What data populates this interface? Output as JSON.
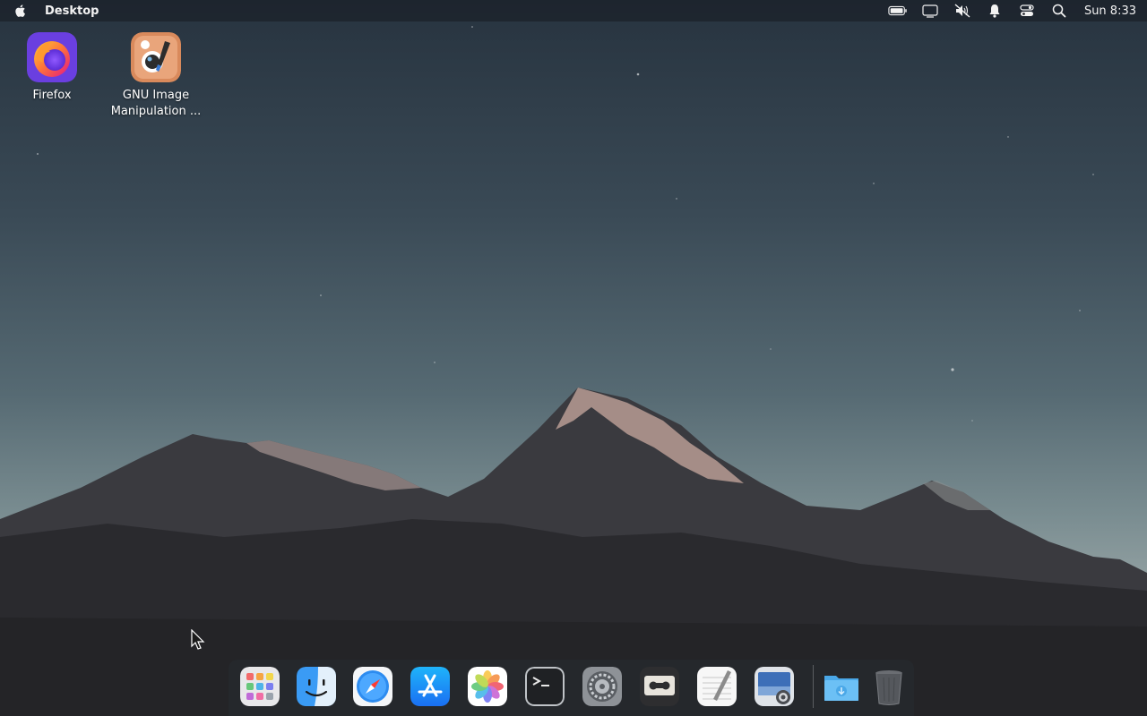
{
  "menubar": {
    "active_app": "Desktop",
    "clock": "Sun 8:33",
    "status_icons": [
      "battery-icon",
      "display-icon",
      "volume-muted-icon",
      "notification-bell-icon",
      "control-center-icon",
      "search-icon"
    ]
  },
  "desktop": {
    "icons": [
      {
        "label": "Firefox",
        "icon": "firefox-icon"
      },
      {
        "label": "GNU Image Manipulation ...",
        "icon": "gimp-icon"
      }
    ]
  },
  "dock": {
    "apps": [
      {
        "icon": "launchpad-icon"
      },
      {
        "icon": "finder-icon"
      },
      {
        "icon": "safari-icon"
      },
      {
        "icon": "app-store-icon"
      },
      {
        "icon": "photos-icon"
      },
      {
        "icon": "terminal-icon"
      },
      {
        "icon": "system-settings-icon"
      },
      {
        "icon": "tape-recorder-icon"
      },
      {
        "icon": "text-editor-icon"
      },
      {
        "icon": "screenshot-icon"
      },
      {
        "icon": "downloads-folder-icon"
      },
      {
        "icon": "trash-icon"
      }
    ]
  },
  "colors": {
    "sky_top": "#27333f",
    "sky_bottom": "#8e9d9f",
    "mountain_dark": "#2a2a2e",
    "snow": "#c9a9a0"
  }
}
